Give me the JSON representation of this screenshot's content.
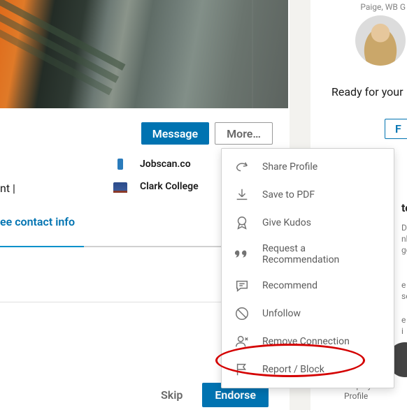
{
  "buttons": {
    "message": "Message",
    "more": "More…",
    "skip": "Skip",
    "endorse": "Endorse",
    "follow_fragment": "F"
  },
  "orgs": {
    "jobscan": "Jobscan.co",
    "college": "Clark College"
  },
  "headline_fragment": "nt |",
  "contact_link": "ee contact info",
  "right": {
    "name_fragment": "Paige, WB G",
    "ready_fragment": "Ready for your",
    "suggest_letter": "to",
    "grey1": "De\nnk\ngg",
    "grey2": "e\nse",
    "grey3": "e\ni",
    "job_fragment": "Employment\nProfile"
  },
  "menu": {
    "share": "Share Profile",
    "save": "Save to PDF",
    "kudos": "Give Kudos",
    "request": "Request a Recommendation",
    "recommend": "Recommend",
    "unfollow": "Unfollow",
    "remove": "Remove Connection",
    "report": "Report / Block"
  }
}
